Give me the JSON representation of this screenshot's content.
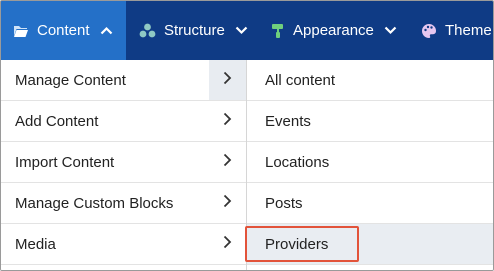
{
  "nav": {
    "content": {
      "label": "Content",
      "icon": "folder-icon",
      "chevron": "chevron-up-icon"
    },
    "structure": {
      "label": "Structure",
      "icon": "structure-icon",
      "chevron": "chevron-down-icon"
    },
    "appearance": {
      "label": "Appearance",
      "icon": "paint-roller-icon",
      "chevron": "chevron-down-icon"
    },
    "theme": {
      "label": "Theme",
      "icon": "palette-icon"
    }
  },
  "menu": {
    "items": [
      {
        "label": "Manage Content"
      },
      {
        "label": "Add Content"
      },
      {
        "label": "Import Content"
      },
      {
        "label": "Manage Custom Blocks"
      },
      {
        "label": "Media"
      }
    ],
    "submenu": [
      {
        "label": "All content"
      },
      {
        "label": "Events"
      },
      {
        "label": "Locations"
      },
      {
        "label": "Posts"
      },
      {
        "label": "Providers"
      }
    ]
  },
  "colors": {
    "nav_bg": "#0f3b85",
    "nav_active": "#2470c8",
    "highlight": "#e2533a",
    "hover_row": "#e9edf2"
  }
}
